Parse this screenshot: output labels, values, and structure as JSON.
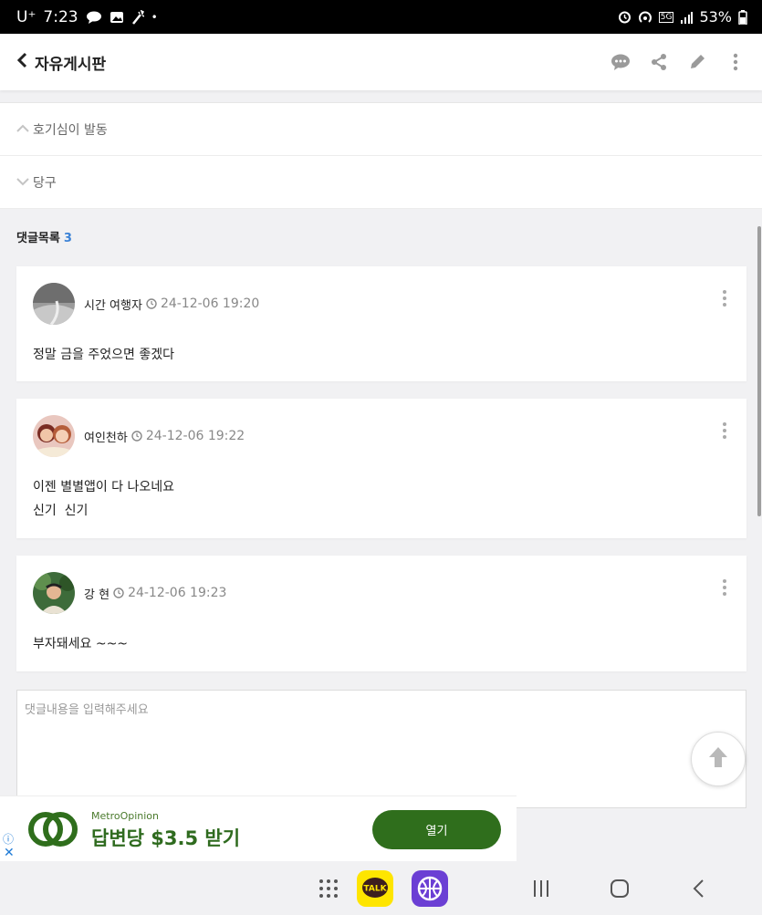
{
  "status_bar": {
    "carrier": "U⁺",
    "time": "7:23",
    "dot": "•",
    "network": "5G",
    "battery": "53%"
  },
  "header": {
    "title": "자유게시판"
  },
  "nav_list": {
    "previous": "호기심이 발동",
    "next": "당구"
  },
  "comments": {
    "title": "댓글목록",
    "count": "3",
    "items": [
      {
        "author": "시간 여행자",
        "date": "24-12-06 19:20",
        "lines": [
          "정말 금을 주었으면 좋겠다"
        ]
      },
      {
        "author": "여인천하",
        "date": "24-12-06 19:22",
        "lines": [
          "이젠 별별앱이 다 나오네요",
          "신기  신기"
        ]
      },
      {
        "author": "강 현",
        "date": "24-12-06 19:23",
        "lines": [
          "부자돼세요 ~~~"
        ]
      }
    ]
  },
  "reply": {
    "placeholder": "댓글내용을 입력해주세요"
  },
  "ad": {
    "brand": "MetroOpinion",
    "headline": "답변당 $3.5 받기",
    "button": "열기",
    "info_symbol": "ⓘ",
    "close_symbol": "✕"
  },
  "navbar": {
    "kakao_label": "TALK"
  },
  "colors": {
    "accent_blue": "#3b82d6",
    "ad_green": "#2f6e1c"
  }
}
